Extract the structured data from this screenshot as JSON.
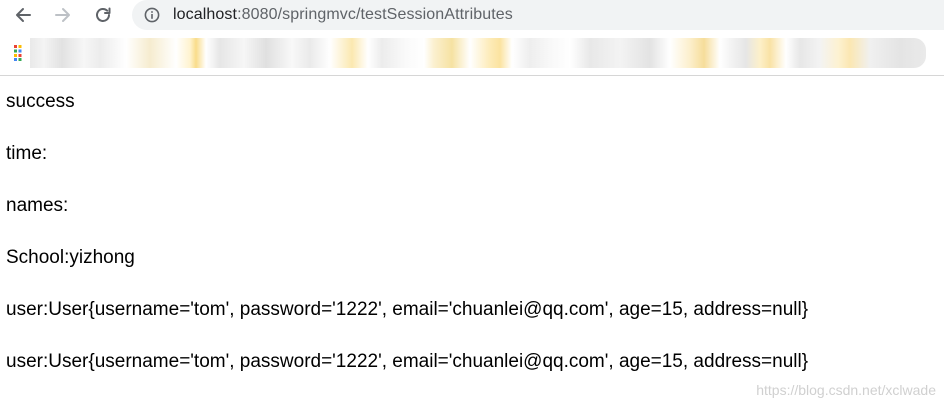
{
  "browser": {
    "url_host": "localhost",
    "url_rest": ":8080/springmvc/testSessionAttributes",
    "icons": [
      "back-arrow-icon",
      "forward-arrow-icon",
      "reload-icon",
      "info-icon",
      "apps-grid-icon"
    ]
  },
  "page": {
    "lines": [
      "success",
      "time:",
      "names:",
      "School:yizhong",
      "user:User{username='tom', password='1222', email='chuanlei@qq.com', age=15, address=null}",
      "user:User{username='tom', password='1222', email='chuanlei@qq.com', age=15, address=null}"
    ]
  },
  "watermark": "https://blog.csdn.net/xclwade",
  "colors": {
    "page_background": "#ffffff",
    "omnibox_background": "#f1f3f4",
    "text": "#000000",
    "url_host": "#202124",
    "url_path": "#5f6368"
  }
}
